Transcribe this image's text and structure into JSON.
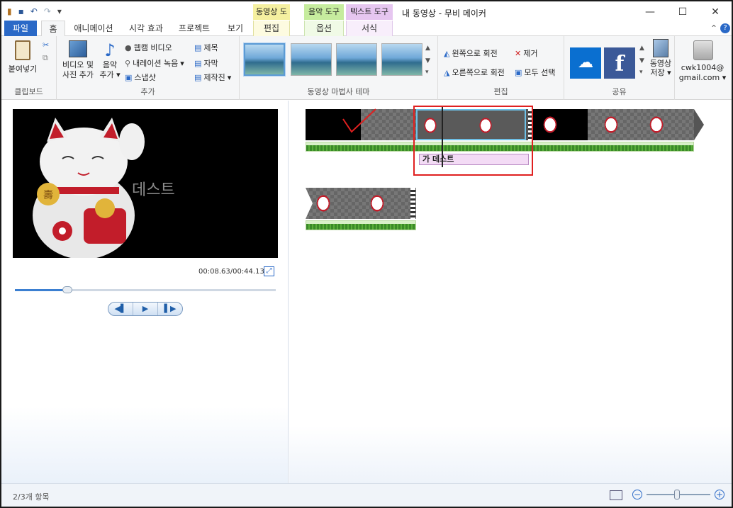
{
  "window": {
    "title": "내 동영상 - 무비 메이커"
  },
  "context_tabs": [
    {
      "header": "동영상 도구",
      "tab": "편집",
      "color": "#f5f0a0"
    },
    {
      "header": "음악 도구",
      "tab": "옵션",
      "color": "#c6ec9e"
    },
    {
      "header": "텍스트 도구",
      "tab": "서식",
      "color": "#e6c6f0"
    }
  ],
  "tabs": {
    "file": "파일",
    "home": "홈",
    "animation": "애니메이션",
    "visual": "시각 효과",
    "project": "프로젝트",
    "view": "보기"
  },
  "ribbon": {
    "clipboard": {
      "paste": "붙여넣기",
      "label": "클립보드"
    },
    "add": {
      "video_photo_1": "비디오 및",
      "video_photo_2": "사진 추가",
      "music_1": "음악",
      "music_2": "추가",
      "webcam": "웹캠 비디오",
      "narration": "내레이션 녹음",
      "snapshot": "스냅샷",
      "title": "제목",
      "caption": "자막",
      "credits": "제작진",
      "label": "추가"
    },
    "themes": {
      "label": "동영상 마법사 테마"
    },
    "edit": {
      "rotate_left": "왼쪽으로 회전",
      "rotate_right": "오른쪽으로 회전",
      "remove": "제거",
      "select_all": "모두 선택",
      "label": "편집"
    },
    "share": {
      "save_1": "동영상",
      "save_2": "저장",
      "label": "공유"
    },
    "account": {
      "line1": "cwk1004@",
      "line2": "gmail.com"
    }
  },
  "preview": {
    "overlay_text": "데스트",
    "time": "00:08.63/00:44.13",
    "seek_position": 0.2
  },
  "timeline": {
    "caption_label": "가 데스트"
  },
  "status": {
    "items": "2/3개 항목",
    "zoom_level": 0.48
  },
  "colors": {
    "accent": "#2a69c7",
    "highlight_box": "#e02020",
    "check_mark": "#e02020"
  }
}
